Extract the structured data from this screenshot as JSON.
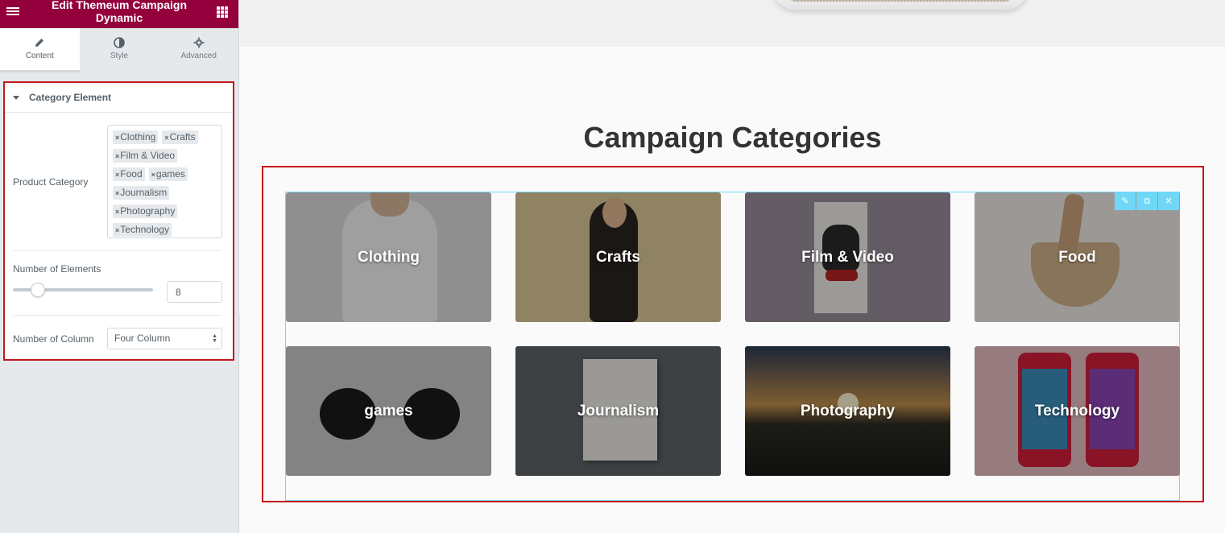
{
  "panel": {
    "title": "Edit Themeum Campaign Dynamic",
    "tabs": [
      {
        "label": "Content",
        "icon": "pencil-icon"
      },
      {
        "label": "Style",
        "icon": "contrast-icon"
      },
      {
        "label": "Advanced",
        "icon": "gear-icon"
      }
    ],
    "section_title": "Category Element",
    "product_category": {
      "label": "Product Category",
      "tags": [
        "Clothing",
        "Crafts",
        "Film & Video",
        "Food",
        "games",
        "Journalism",
        "Photography",
        "Technology"
      ]
    },
    "number_of_elements": {
      "label": "Number of Elements",
      "value": "8",
      "slider_fraction": 0.18
    },
    "number_of_column": {
      "label": "Number of Column",
      "selected": "Four Column"
    }
  },
  "preview": {
    "heading": "Campaign Categories",
    "categories": [
      "Clothing",
      "Crafts",
      "Film & Video",
      "Food",
      "games",
      "Journalism",
      "Photography",
      "Technology"
    ]
  },
  "colors": {
    "header_bg": "#93003c",
    "highlight_outline": "#c4171b",
    "widget_outline": "#71d7f7"
  }
}
